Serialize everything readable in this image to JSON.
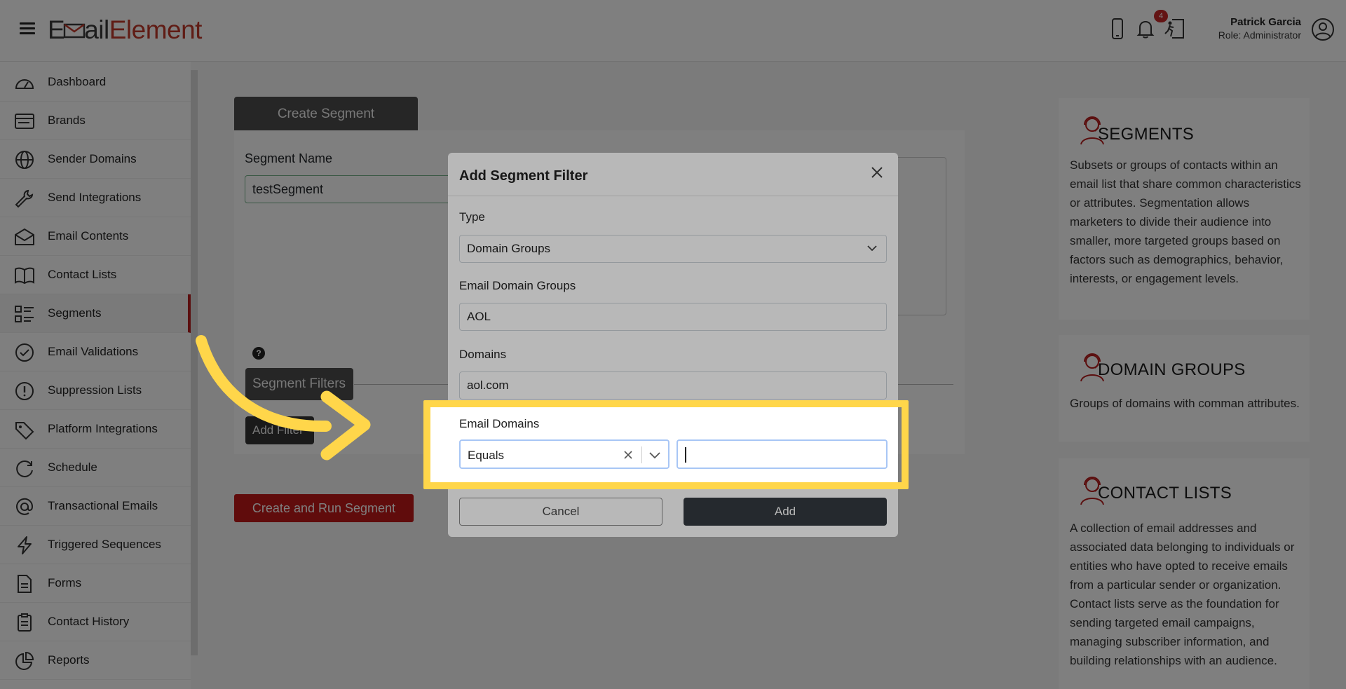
{
  "header": {
    "logo_part1": "E",
    "logo_part2": "ail",
    "logo_part3": "Element",
    "notification_count": "4",
    "user_name": "Patrick Garcia",
    "user_role": "Role: Administrator"
  },
  "sidebar": {
    "items": [
      {
        "label": "Dashboard",
        "icon": "dashboard-icon"
      },
      {
        "label": "Brands",
        "icon": "brands-icon"
      },
      {
        "label": "Sender Domains",
        "icon": "globe-icon"
      },
      {
        "label": "Send Integrations",
        "icon": "wrench-icon"
      },
      {
        "label": "Email Contents",
        "icon": "envelope-icon"
      },
      {
        "label": "Contact Lists",
        "icon": "book-icon"
      },
      {
        "label": "Segments",
        "icon": "segments-icon"
      },
      {
        "label": "Email Validations",
        "icon": "check-circle-icon"
      },
      {
        "label": "Suppression Lists",
        "icon": "exclamation-circle-icon"
      },
      {
        "label": "Platform Integrations",
        "icon": "tag-icon"
      },
      {
        "label": "Schedule",
        "icon": "schedule-icon"
      },
      {
        "label": "Transactional Emails",
        "icon": "at-icon"
      },
      {
        "label": "Triggered Sequences",
        "icon": "lightning-icon"
      },
      {
        "label": "Forms",
        "icon": "file-icon"
      },
      {
        "label": "Contact History",
        "icon": "clipboard-icon"
      },
      {
        "label": "Reports",
        "icon": "pie-chart-icon"
      }
    ],
    "active": "Segments"
  },
  "main": {
    "tab_label": "Create Segment",
    "segment_name_label": "Segment Name",
    "segment_name_value": "testSegment",
    "segment_filters_label": "Segment Filters",
    "add_filter_label": "Add Filter",
    "create_run_label": "Create and Run Segment"
  },
  "info_panels": [
    {
      "title": "SEGMENTS",
      "body": "Subsets or groups of contacts within an email list that share common characteristics or attributes. Segmentation allows marketers to divide their audience into smaller, more targeted groups based on factors such as demographics, behavior, interests, or engagement levels."
    },
    {
      "title": "DOMAIN GROUPS",
      "body": "Groups of domains with comman attributes."
    },
    {
      "title": "CONTACT LISTS",
      "body": "A collection of email addresses and associated data belonging to individuals or entities who have opted to receive emails from a particular sender or organization. Contact lists serve as the foundation for sending targeted email campaigns, managing subscriber information, and building relationships with an audience."
    }
  ],
  "modal": {
    "title": "Add Segment Filter",
    "type_label": "Type",
    "type_value": "Domain Groups",
    "domain_groups_label": "Email Domain Groups",
    "domain_groups_value": "AOL",
    "domains_label": "Domains",
    "domains_value": "aol.com",
    "email_domains_label": "Email Domains",
    "operator_value": "Equals",
    "domain_input_value": "",
    "cancel_label": "Cancel",
    "add_label": "Add"
  },
  "colors": {
    "brand_red": "#c01818",
    "highlight_yellow": "#ffd64a",
    "dark_button": "#343a40"
  }
}
